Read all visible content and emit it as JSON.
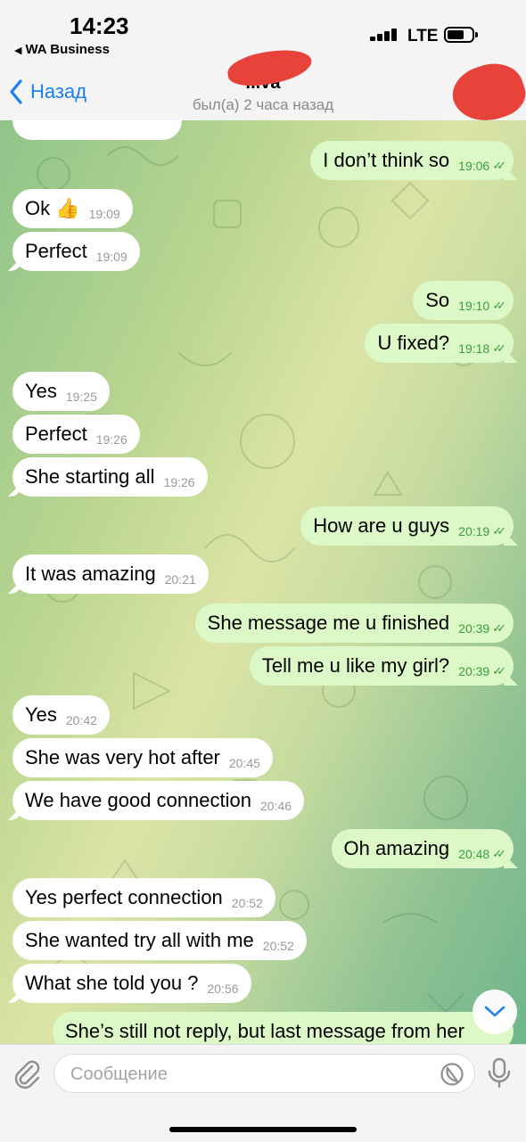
{
  "status_bar": {
    "time": "14:23",
    "back_app": "WA Business",
    "network": "LTE"
  },
  "header": {
    "back_label": "Назад",
    "name": "...va",
    "last_seen": "был(а) 2 часа назад"
  },
  "messages": [
    {
      "dir": "out",
      "text": "I don’t think so",
      "time": "19:06"
    },
    {
      "dir": "in",
      "text": "Ok 👍",
      "time": "19:09"
    },
    {
      "dir": "in",
      "text": "Perfect",
      "time": "19:09"
    },
    {
      "dir": "out",
      "text": "So",
      "time": "19:10"
    },
    {
      "dir": "out",
      "text": "U fixed?",
      "time": "19:18"
    },
    {
      "dir": "in",
      "text": "Yes",
      "time": "19:25"
    },
    {
      "dir": "in",
      "text": "Perfect",
      "time": "19:26"
    },
    {
      "dir": "in",
      "text": "She starting all",
      "time": "19:26"
    },
    {
      "dir": "out",
      "text": "How are u guys",
      "time": "20:19"
    },
    {
      "dir": "in",
      "text": "It was amazing",
      "time": "20:21"
    },
    {
      "dir": "out",
      "text": "She message me u finished",
      "time": "20:39"
    },
    {
      "dir": "out",
      "text": "Tell me u like my girl?",
      "time": "20:39"
    },
    {
      "dir": "in",
      "text": "Yes",
      "time": "20:42"
    },
    {
      "dir": "in",
      "text": "She was very hot after",
      "time": "20:45"
    },
    {
      "dir": "in",
      "text": "We have good connection",
      "time": "20:46"
    },
    {
      "dir": "out",
      "text": "Oh amazing",
      "time": "20:48"
    },
    {
      "dir": "in",
      "text": "Yes perfect connection",
      "time": "20:52"
    },
    {
      "dir": "in",
      "text": "She wanted try all with me",
      "time": "20:52"
    },
    {
      "dir": "in",
      "text": "What she told you ?",
      "time": "20:56"
    },
    {
      "dir": "out",
      "text": "She’s still not reply, but last message from her",
      "time": ""
    }
  ],
  "input": {
    "placeholder": "Сообщение",
    "value": ""
  },
  "colors": {
    "accent": "#1a7ff0",
    "incoming_bubble": "#ffffff",
    "outgoing_bubble": "#dcf8c6",
    "read_check": "#3a9e3a",
    "redaction": "#e8433b"
  },
  "icons": {
    "back": "chevron-left-icon",
    "attach": "paperclip-icon",
    "sticker": "sticker-icon",
    "mic": "microphone-icon",
    "scroll": "chevron-down-icon",
    "read": "double-check-icon"
  }
}
